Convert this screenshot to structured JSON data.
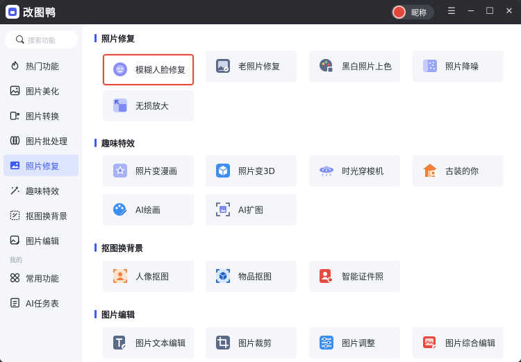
{
  "app": {
    "title": "改图鸭",
    "user_name": "昵称"
  },
  "window_controls": {
    "menu": "☰",
    "minimize": "─",
    "maximize": "☐",
    "close": "✕"
  },
  "search": {
    "placeholder": "搜索功能"
  },
  "sidebar": {
    "items": [
      {
        "label": "热门功能",
        "icon": "fire-icon"
      },
      {
        "label": "图片美化",
        "icon": "image-beautify-icon"
      },
      {
        "label": "图片转换",
        "icon": "convert-icon"
      },
      {
        "label": "图片批处理",
        "icon": "batch-icon"
      },
      {
        "label": "照片修复",
        "icon": "photo-repair-icon",
        "active": true
      },
      {
        "label": "趣味特效",
        "icon": "magic-wand-icon"
      },
      {
        "label": "抠图换背景",
        "icon": "cutout-icon"
      },
      {
        "label": "图片编辑",
        "icon": "image-edit-icon"
      }
    ],
    "group_label": "我的",
    "my_items": [
      {
        "label": "常用功能",
        "icon": "grid-icon"
      },
      {
        "label": "AI任务表",
        "icon": "task-list-icon"
      }
    ]
  },
  "sections": [
    {
      "title": "照片修复",
      "tiles": [
        {
          "label": "模糊人脸修复",
          "icon": "face-repair-icon",
          "selected": true
        },
        {
          "label": "老照片修复",
          "icon": "old-photo-icon"
        },
        {
          "label": "黑白照片上色",
          "icon": "colorize-icon"
        },
        {
          "label": "照片降噪",
          "icon": "denoise-icon"
        },
        {
          "label": "无损放大",
          "icon": "upscale-icon"
        }
      ]
    },
    {
      "title": "趣味特效",
      "tiles": [
        {
          "label": "照片变漫画",
          "icon": "comic-icon"
        },
        {
          "label": "照片变3D",
          "icon": "cube-3d-icon"
        },
        {
          "label": "时光穿梭机",
          "icon": "time-machine-icon"
        },
        {
          "label": "古装的你",
          "icon": "costume-icon"
        },
        {
          "label": "AI绘画",
          "icon": "ai-paint-icon"
        },
        {
          "label": "AI扩图",
          "icon": "ai-expand-icon"
        }
      ]
    },
    {
      "title": "抠图换背景",
      "tiles": [
        {
          "label": "人像抠图",
          "icon": "portrait-cutout-icon"
        },
        {
          "label": "物品抠图",
          "icon": "object-cutout-icon"
        },
        {
          "label": "智能证件照",
          "icon": "id-photo-icon"
        }
      ]
    },
    {
      "title": "图片编辑",
      "tiles": [
        {
          "label": "图片文本编辑",
          "icon": "text-edit-icon"
        },
        {
          "label": "图片裁剪",
          "icon": "crop-icon"
        },
        {
          "label": "图片调整",
          "icon": "adjust-icon"
        },
        {
          "label": "图片综合编辑",
          "icon": "comprehensive-edit-icon"
        }
      ]
    }
  ],
  "colors": {
    "accent": "#3d5af1",
    "selected_border": "#e64b3f",
    "titlebar": "#2b2d33"
  }
}
